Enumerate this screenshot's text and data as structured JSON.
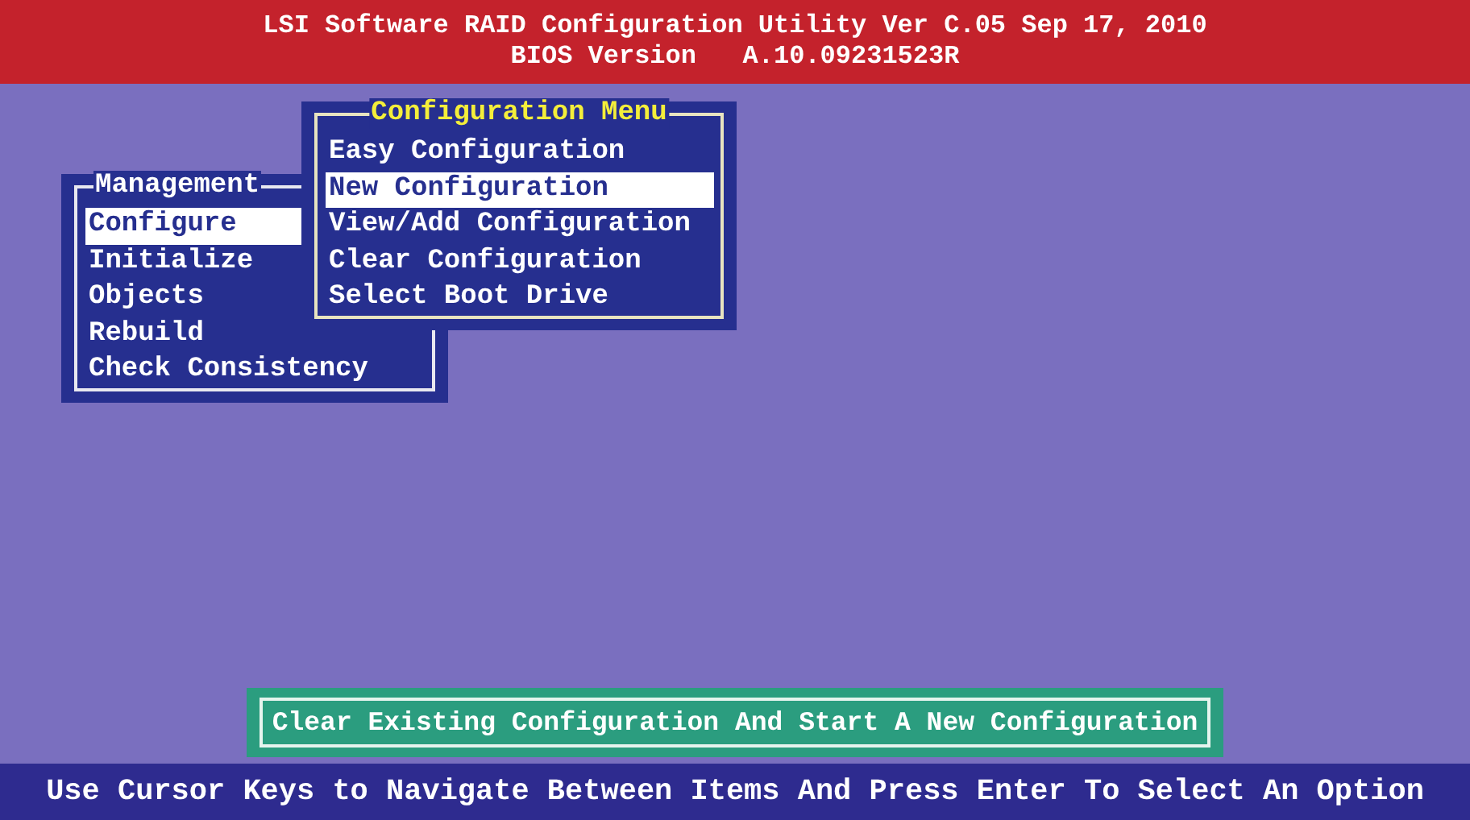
{
  "header": {
    "title": "LSI Software RAID Configuration Utility Ver C.05 Sep 17, 2010",
    "subtitle": "BIOS Version   A.10.09231523R"
  },
  "menus": [
    {
      "title": "Management",
      "items": [
        {
          "label": "Configure",
          "selected": true
        },
        {
          "label": "Initialize",
          "selected": false
        },
        {
          "label": "Objects",
          "selected": false
        },
        {
          "label": "Rebuild",
          "selected": false
        },
        {
          "label": "Check Consistency",
          "selected": false
        }
      ]
    },
    {
      "title": "Configuration Menu",
      "items": [
        {
          "label": "Easy Configuration",
          "selected": false
        },
        {
          "label": "New Configuration",
          "selected": true
        },
        {
          "label": "View/Add Configuration",
          "selected": false
        },
        {
          "label": "Clear Configuration",
          "selected": false
        },
        {
          "label": "Select Boot Drive",
          "selected": false
        }
      ]
    }
  ],
  "help_text": "Clear Existing Configuration And Start A New Configuration",
  "status_bar": "Use Cursor Keys to Navigate Between Items And Press Enter To Select An Option"
}
